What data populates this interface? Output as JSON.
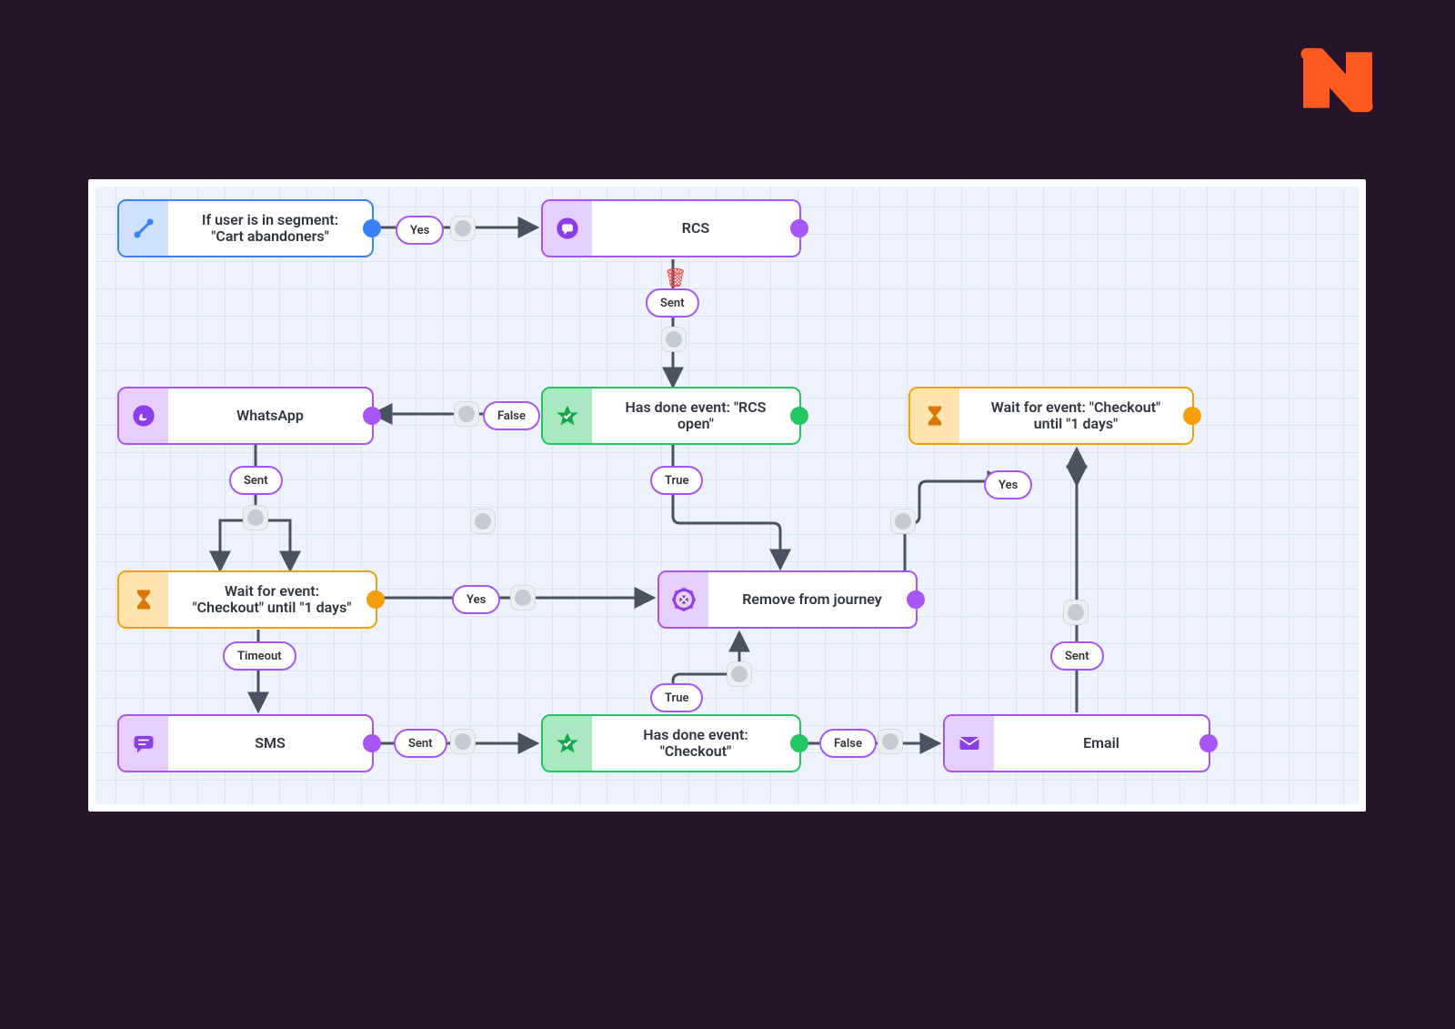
{
  "brand_logo": "N",
  "colors": {
    "bg": "#27132a",
    "panel": "#eef2fc",
    "grid": "#dbe4f5",
    "blue": "#3b82f6",
    "purple": "#a855f7",
    "green": "#22c55e",
    "amber": "#f59e0b",
    "red": "#ef4444",
    "edge": "#4a5160"
  },
  "nodes": {
    "segment": {
      "type": "condition",
      "label": "If user is in segment: \"Cart abandoners\"",
      "icon": "branch-icon",
      "color": "blue"
    },
    "rcs": {
      "type": "channel",
      "label": "RCS",
      "icon": "chat-icon",
      "color": "purple"
    },
    "whatsapp": {
      "type": "channel",
      "label": "WhatsApp",
      "icon": "whatsapp-icon",
      "color": "purple"
    },
    "rcs_open": {
      "type": "event_check",
      "label": "Has done event: \"RCS open\"",
      "icon": "star-icon",
      "color": "green"
    },
    "wait1": {
      "type": "wait",
      "label": "Wait for event: \"Checkout\" until \"1 days\"",
      "icon": "hourglass-icon",
      "color": "amber"
    },
    "wait2": {
      "type": "wait",
      "label": "Wait for event: \"Checkout\" until \"1 days\"",
      "icon": "hourglass-icon",
      "color": "amber"
    },
    "remove": {
      "type": "action",
      "label": "Remove from journey",
      "icon": "gear-close-icon",
      "color": "purple"
    },
    "sms": {
      "type": "channel",
      "label": "SMS",
      "icon": "sms-icon",
      "color": "purple"
    },
    "checkout": {
      "type": "event_check",
      "label": "Has done event: \"Checkout\"",
      "icon": "star-icon",
      "color": "green"
    },
    "email": {
      "type": "channel",
      "label": "Email",
      "icon": "mail-icon",
      "color": "purple"
    }
  },
  "edges": {
    "seg_to_rcs": {
      "from": "segment",
      "to": "rcs",
      "label": "Yes"
    },
    "rcs_down": {
      "from": "rcs",
      "to": "rcs_open",
      "label": "Sent"
    },
    "rcs_false": {
      "from": "rcs_open",
      "to": "whatsapp",
      "label": "False"
    },
    "rcs_true": {
      "from": "rcs_open",
      "to": "remove",
      "label": "True"
    },
    "wa_down": {
      "from": "whatsapp",
      "to": "wait1",
      "label": "Sent"
    },
    "wait1_yes": {
      "from": "wait1",
      "to": "remove",
      "label": "Yes"
    },
    "wait1_timeout": {
      "from": "wait1",
      "to": "sms",
      "label": "Timeout"
    },
    "sms_to_check": {
      "from": "sms",
      "to": "checkout",
      "label": "Sent"
    },
    "check_true": {
      "from": "checkout",
      "to": "remove",
      "label": "True"
    },
    "check_false": {
      "from": "checkout",
      "to": "email",
      "label": "False"
    },
    "email_up": {
      "from": "email",
      "to": "wait2",
      "label": "Sent"
    },
    "wait2_yes": {
      "from": "wait2",
      "to": "remove",
      "label": "Yes"
    }
  },
  "icons_on_canvas": {
    "delete_above_sent": "trash-icon",
    "delay_markers": "clock-icon"
  }
}
